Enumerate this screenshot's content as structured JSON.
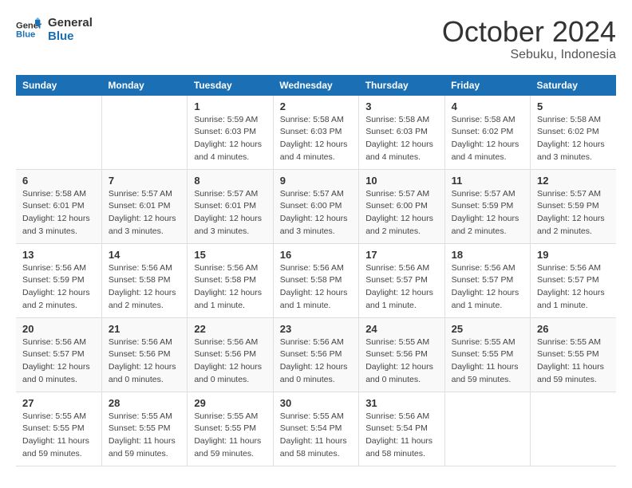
{
  "header": {
    "logo_line1": "General",
    "logo_line2": "Blue",
    "month": "October 2024",
    "location": "Sebuku, Indonesia"
  },
  "weekdays": [
    "Sunday",
    "Monday",
    "Tuesday",
    "Wednesday",
    "Thursday",
    "Friday",
    "Saturday"
  ],
  "weeks": [
    [
      {
        "day": "",
        "info": ""
      },
      {
        "day": "",
        "info": ""
      },
      {
        "day": "1",
        "info": "Sunrise: 5:59 AM\nSunset: 6:03 PM\nDaylight: 12 hours\nand 4 minutes."
      },
      {
        "day": "2",
        "info": "Sunrise: 5:58 AM\nSunset: 6:03 PM\nDaylight: 12 hours\nand 4 minutes."
      },
      {
        "day": "3",
        "info": "Sunrise: 5:58 AM\nSunset: 6:03 PM\nDaylight: 12 hours\nand 4 minutes."
      },
      {
        "day": "4",
        "info": "Sunrise: 5:58 AM\nSunset: 6:02 PM\nDaylight: 12 hours\nand 4 minutes."
      },
      {
        "day": "5",
        "info": "Sunrise: 5:58 AM\nSunset: 6:02 PM\nDaylight: 12 hours\nand 3 minutes."
      }
    ],
    [
      {
        "day": "6",
        "info": "Sunrise: 5:58 AM\nSunset: 6:01 PM\nDaylight: 12 hours\nand 3 minutes."
      },
      {
        "day": "7",
        "info": "Sunrise: 5:57 AM\nSunset: 6:01 PM\nDaylight: 12 hours\nand 3 minutes."
      },
      {
        "day": "8",
        "info": "Sunrise: 5:57 AM\nSunset: 6:01 PM\nDaylight: 12 hours\nand 3 minutes."
      },
      {
        "day": "9",
        "info": "Sunrise: 5:57 AM\nSunset: 6:00 PM\nDaylight: 12 hours\nand 3 minutes."
      },
      {
        "day": "10",
        "info": "Sunrise: 5:57 AM\nSunset: 6:00 PM\nDaylight: 12 hours\nand 2 minutes."
      },
      {
        "day": "11",
        "info": "Sunrise: 5:57 AM\nSunset: 5:59 PM\nDaylight: 12 hours\nand 2 minutes."
      },
      {
        "day": "12",
        "info": "Sunrise: 5:57 AM\nSunset: 5:59 PM\nDaylight: 12 hours\nand 2 minutes."
      }
    ],
    [
      {
        "day": "13",
        "info": "Sunrise: 5:56 AM\nSunset: 5:59 PM\nDaylight: 12 hours\nand 2 minutes."
      },
      {
        "day": "14",
        "info": "Sunrise: 5:56 AM\nSunset: 5:58 PM\nDaylight: 12 hours\nand 2 minutes."
      },
      {
        "day": "15",
        "info": "Sunrise: 5:56 AM\nSunset: 5:58 PM\nDaylight: 12 hours\nand 1 minute."
      },
      {
        "day": "16",
        "info": "Sunrise: 5:56 AM\nSunset: 5:58 PM\nDaylight: 12 hours\nand 1 minute."
      },
      {
        "day": "17",
        "info": "Sunrise: 5:56 AM\nSunset: 5:57 PM\nDaylight: 12 hours\nand 1 minute."
      },
      {
        "day": "18",
        "info": "Sunrise: 5:56 AM\nSunset: 5:57 PM\nDaylight: 12 hours\nand 1 minute."
      },
      {
        "day": "19",
        "info": "Sunrise: 5:56 AM\nSunset: 5:57 PM\nDaylight: 12 hours\nand 1 minute."
      }
    ],
    [
      {
        "day": "20",
        "info": "Sunrise: 5:56 AM\nSunset: 5:57 PM\nDaylight: 12 hours\nand 0 minutes."
      },
      {
        "day": "21",
        "info": "Sunrise: 5:56 AM\nSunset: 5:56 PM\nDaylight: 12 hours\nand 0 minutes."
      },
      {
        "day": "22",
        "info": "Sunrise: 5:56 AM\nSunset: 5:56 PM\nDaylight: 12 hours\nand 0 minutes."
      },
      {
        "day": "23",
        "info": "Sunrise: 5:56 AM\nSunset: 5:56 PM\nDaylight: 12 hours\nand 0 minutes."
      },
      {
        "day": "24",
        "info": "Sunrise: 5:55 AM\nSunset: 5:56 PM\nDaylight: 12 hours\nand 0 minutes."
      },
      {
        "day": "25",
        "info": "Sunrise: 5:55 AM\nSunset: 5:55 PM\nDaylight: 11 hours\nand 59 minutes."
      },
      {
        "day": "26",
        "info": "Sunrise: 5:55 AM\nSunset: 5:55 PM\nDaylight: 11 hours\nand 59 minutes."
      }
    ],
    [
      {
        "day": "27",
        "info": "Sunrise: 5:55 AM\nSunset: 5:55 PM\nDaylight: 11 hours\nand 59 minutes."
      },
      {
        "day": "28",
        "info": "Sunrise: 5:55 AM\nSunset: 5:55 PM\nDaylight: 11 hours\nand 59 minutes."
      },
      {
        "day": "29",
        "info": "Sunrise: 5:55 AM\nSunset: 5:55 PM\nDaylight: 11 hours\nand 59 minutes."
      },
      {
        "day": "30",
        "info": "Sunrise: 5:55 AM\nSunset: 5:54 PM\nDaylight: 11 hours\nand 58 minutes."
      },
      {
        "day": "31",
        "info": "Sunrise: 5:56 AM\nSunset: 5:54 PM\nDaylight: 11 hours\nand 58 minutes."
      },
      {
        "day": "",
        "info": ""
      },
      {
        "day": "",
        "info": ""
      }
    ]
  ]
}
